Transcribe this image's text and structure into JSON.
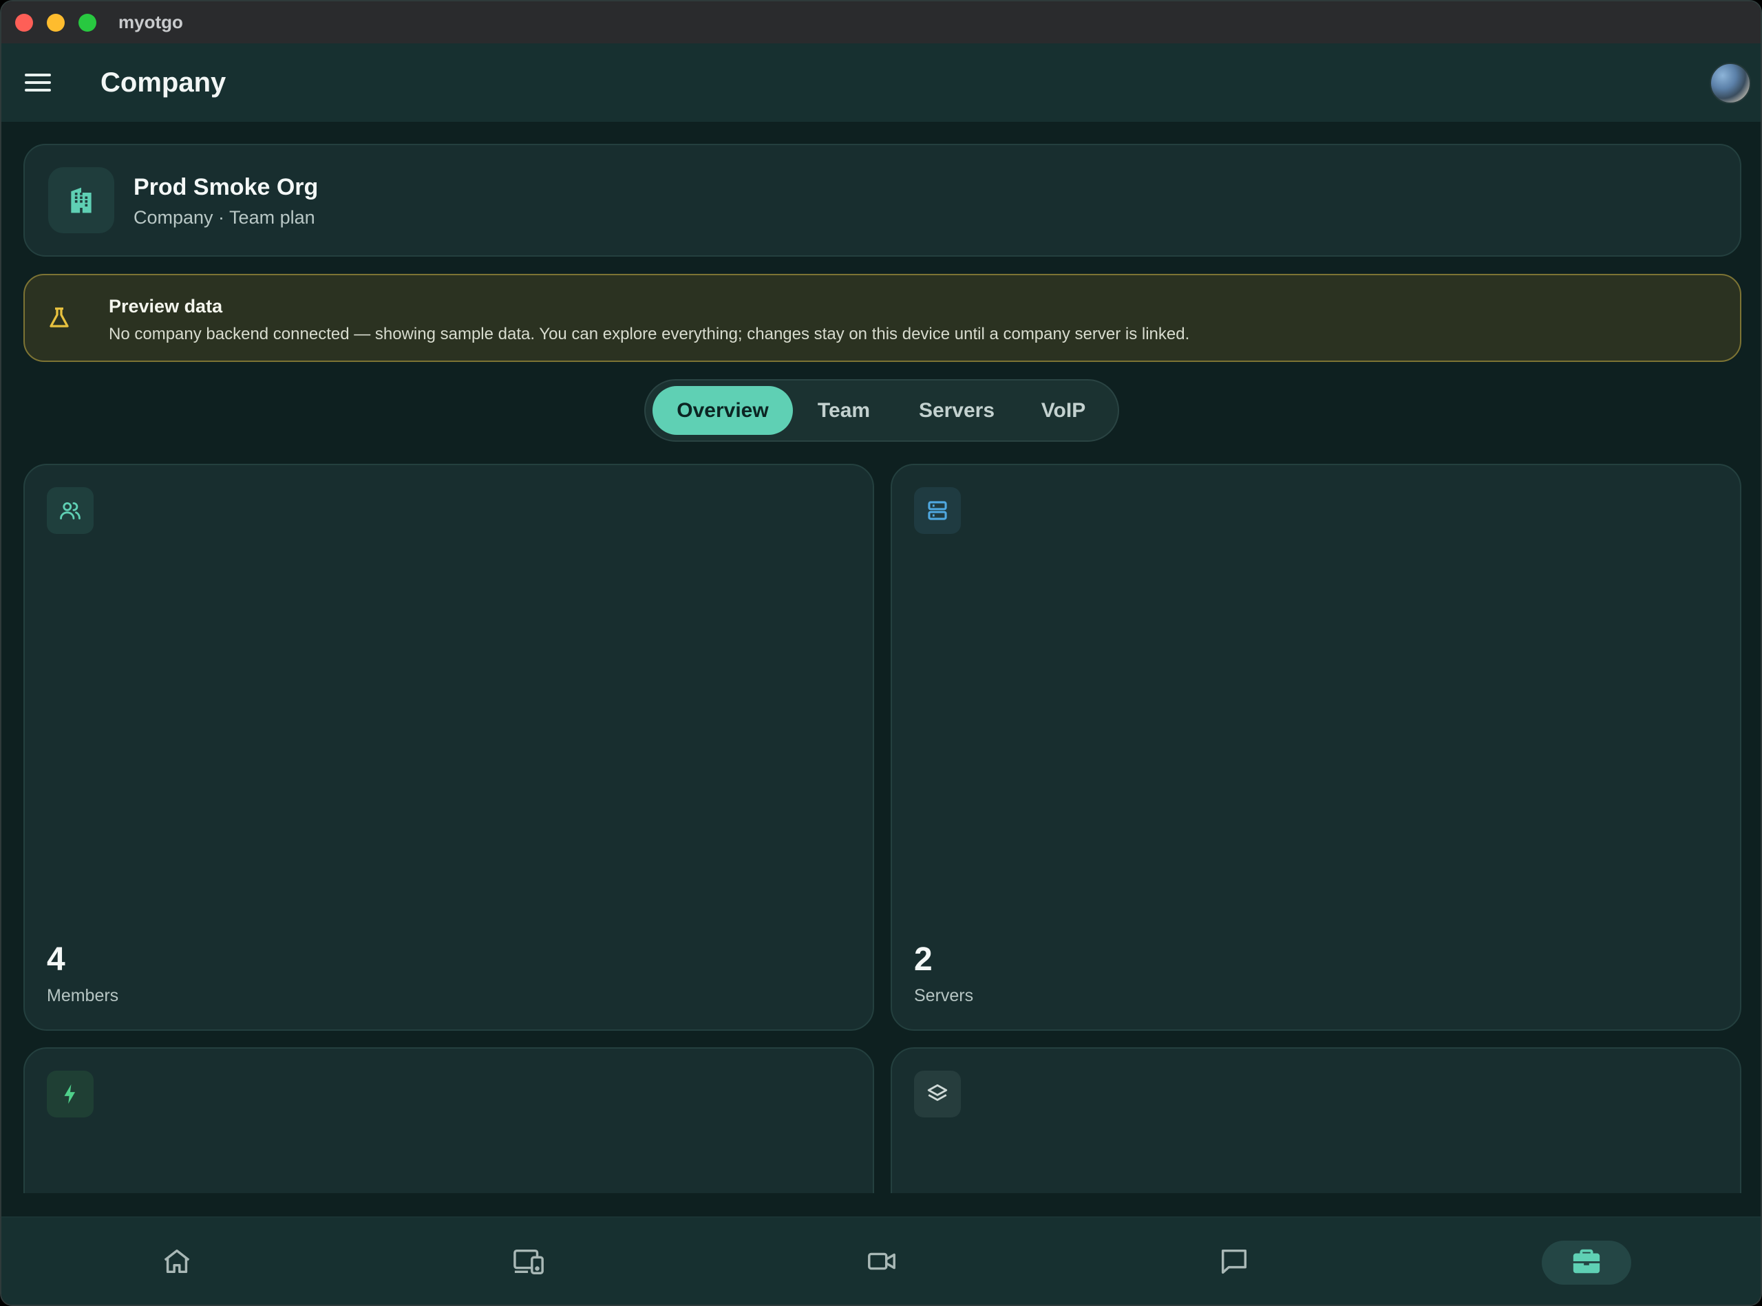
{
  "window": {
    "title": "myotgo"
  },
  "header": {
    "title": "Company"
  },
  "org": {
    "name": "Prod Smoke Org",
    "subtitle": "Company · Team plan"
  },
  "preview": {
    "title": "Preview data",
    "message": "No company backend connected — showing sample data. You can explore everything; changes stay on this device until a company server is linked."
  },
  "tabs": [
    {
      "label": "Overview",
      "active": true
    },
    {
      "label": "Team",
      "active": false
    },
    {
      "label": "Servers",
      "active": false
    },
    {
      "label": "VoIP",
      "active": false
    }
  ],
  "stats": [
    {
      "icon": "users-icon",
      "value": "4",
      "label": "Members"
    },
    {
      "icon": "server-icon",
      "value": "2",
      "label": "Servers"
    },
    {
      "icon": "lightning-icon",
      "value": "",
      "label": ""
    },
    {
      "icon": "layers-icon",
      "value": "",
      "label": ""
    }
  ],
  "bottom_nav": [
    {
      "icon": "home-icon",
      "active": false
    },
    {
      "icon": "devices-icon",
      "active": false
    },
    {
      "icon": "video-icon",
      "active": false
    },
    {
      "icon": "chat-icon",
      "active": false
    },
    {
      "icon": "briefcase-icon",
      "active": true
    }
  ],
  "colors": {
    "accent": "#5fd0b4",
    "background": "#0e2020",
    "card": "#182e2f",
    "warning_border": "#7d7434"
  }
}
